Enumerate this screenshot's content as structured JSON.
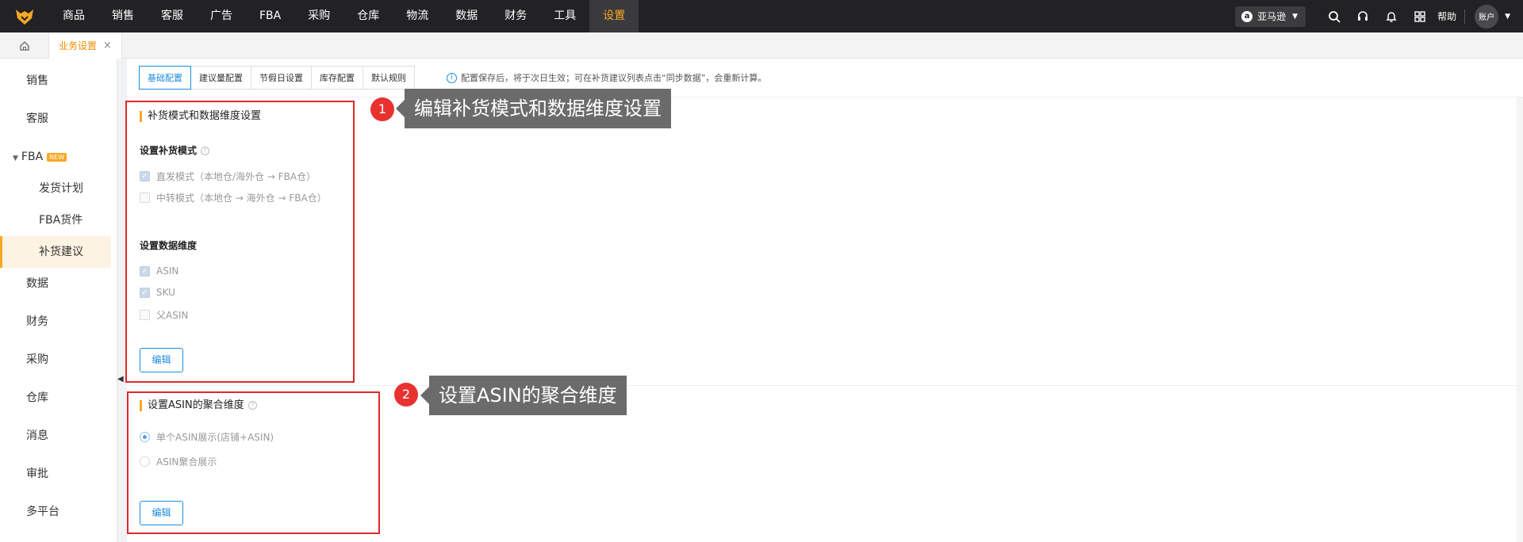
{
  "topnav": {
    "items": [
      "商品",
      "销售",
      "客服",
      "广告",
      "FBA",
      "采购",
      "仓库",
      "物流",
      "数据",
      "财务",
      "工具",
      "设置"
    ],
    "active_index": 11,
    "store": "亚马逊",
    "help": "帮助",
    "account": "账户",
    "colors": {
      "bar": "#222224",
      "accent": "#f7a824"
    }
  },
  "tabs": {
    "active": "业务设置",
    "close": "×"
  },
  "sidebar": {
    "items": [
      "销售",
      "客服",
      "FBA",
      "发货计划",
      "FBA货件",
      "补货建议",
      "数据",
      "财务",
      "采购",
      "仓库",
      "消息",
      "审批",
      "多平台"
    ],
    "new_badge": "NEW",
    "active": "补货建议"
  },
  "main": {
    "subtabs": [
      "基础配置",
      "建议量配置",
      "节假日设置",
      "库存配置",
      "默认规则"
    ],
    "active_subtab": 0,
    "tip": "配置保存后，将于次日生效；可在补货建议列表点击“同步数据”，会重新计算。",
    "section1": {
      "title": "补货模式和数据维度设置",
      "mode_title": "设置补货模式",
      "modes": [
        {
          "label": "直发模式（本地仓/海外仓 → FBA仓）",
          "checked": true
        },
        {
          "label": "中转模式（本地仓 → 海外仓 → FBA仓）",
          "checked": false
        }
      ],
      "dim_title": "设置数据维度",
      "dims": [
        {
          "label": "ASIN",
          "checked": true
        },
        {
          "label": "SKU",
          "checked": true
        },
        {
          "label": "父ASIN",
          "checked": false
        }
      ],
      "edit": "编辑"
    },
    "section2": {
      "title": "设置ASIN的聚合维度",
      "options": [
        {
          "label": "单个ASIN展示(店铺+ASIN)",
          "checked": true
        },
        {
          "label": "ASIN聚合展示",
          "checked": false
        }
      ],
      "edit": "编辑"
    }
  },
  "annotations": [
    {
      "num": "1",
      "text": "编辑补货模式和数据维度设置"
    },
    {
      "num": "2",
      "text": "设置ASIN的聚合维度"
    }
  ],
  "highlight_color": "#e0282c"
}
